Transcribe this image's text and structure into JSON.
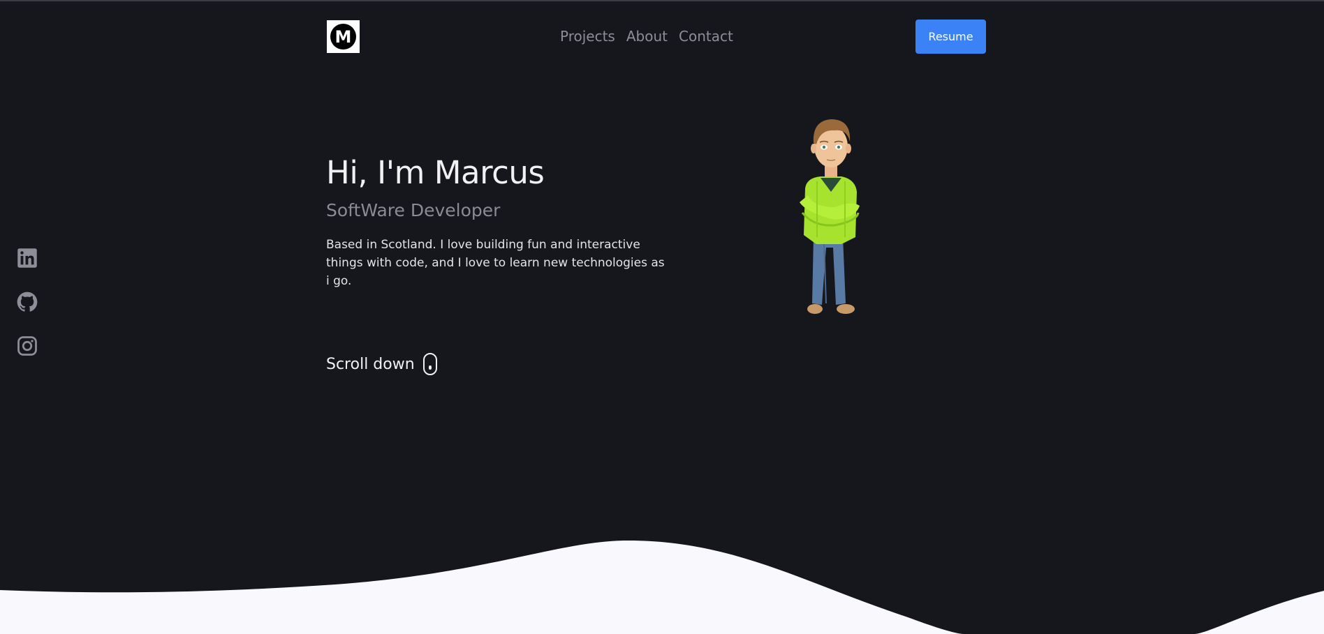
{
  "header": {
    "logo_letter": "M",
    "nav": [
      {
        "label": "Projects"
      },
      {
        "label": "About"
      },
      {
        "label": "Contact"
      }
    ],
    "resume_label": "Resume"
  },
  "hero": {
    "title": "Hi, I'm Marcus",
    "subtitle": "SoftWare Developer",
    "description": "Based in Scotland. I love building fun and interactive things with code, and I love to learn new technologies as i go.",
    "scroll_label": "Scroll down"
  },
  "social": [
    "linkedin-icon",
    "github-icon",
    "instagram-icon"
  ],
  "colors": {
    "background": "#16161d",
    "accent": "#3b82f6",
    "nav_text": "#8d8e98",
    "wave": "#f8f8fd"
  }
}
